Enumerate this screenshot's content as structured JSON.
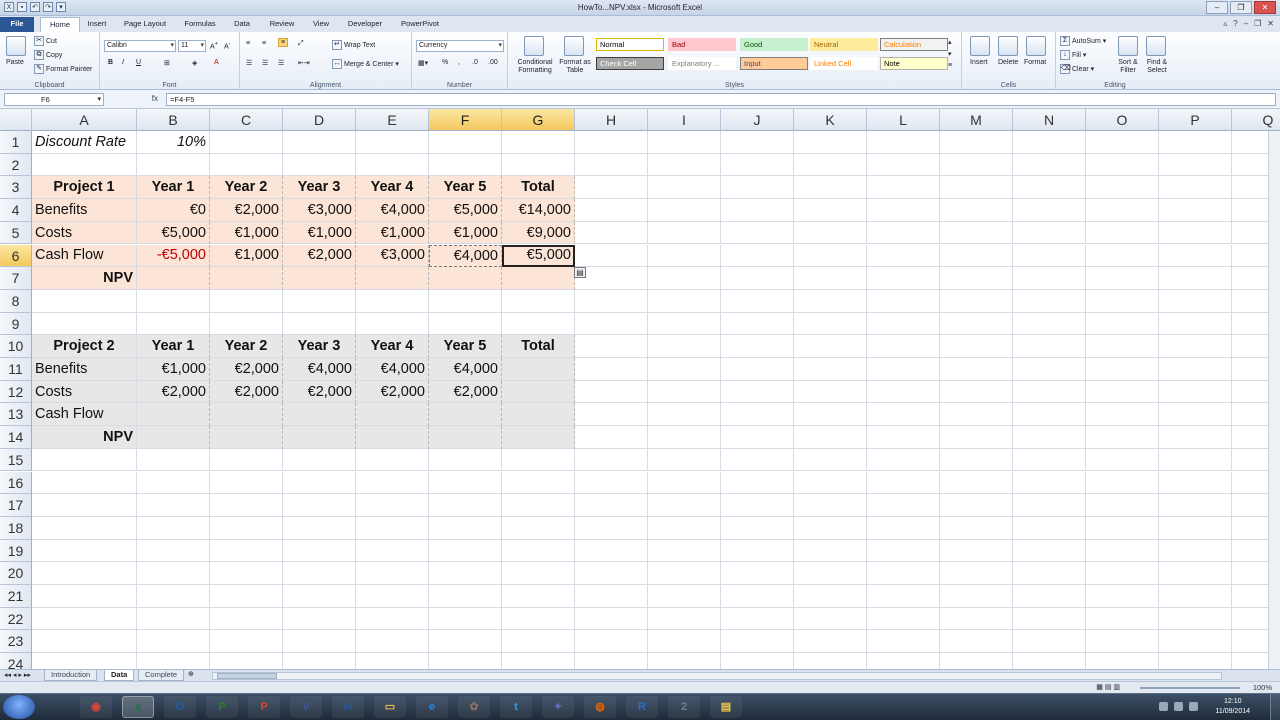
{
  "window": {
    "title": "HowTo...NPV.xlsx - Microsoft Excel",
    "qat_icons": [
      "save-icon",
      "undo-icon",
      "redo-icon",
      "customize-icon"
    ]
  },
  "ribbon_tabs": [
    "File",
    "Home",
    "Insert",
    "Page Layout",
    "Formulas",
    "Data",
    "Review",
    "View",
    "Developer",
    "PowerPivot"
  ],
  "ribbon": {
    "clipboard": {
      "paste": "Paste",
      "cut": "Cut",
      "copy": "Copy",
      "format_painter": "Format Painter",
      "label": "Clipboard"
    },
    "font": {
      "name": "Calibri",
      "size": "11",
      "label": "Font"
    },
    "alignment": {
      "wrap": "Wrap Text",
      "merge": "Merge & Center",
      "label": "Alignment"
    },
    "number": {
      "format": "Currency",
      "label": "Number"
    },
    "styles": {
      "conditional": "Conditional Formatting",
      "format_table": "Format as Table",
      "label": "Styles",
      "gallery": [
        {
          "name": "Normal",
          "bg": "#ffffff",
          "fg": "#000000",
          "border": "#e3b400"
        },
        {
          "name": "Bad",
          "bg": "#ffc7ce",
          "fg": "#9c0006",
          "border": "#ffc7ce"
        },
        {
          "name": "Good",
          "bg": "#c6efce",
          "fg": "#006100",
          "border": "#c6efce"
        },
        {
          "name": "Neutral",
          "bg": "#ffeb9c",
          "fg": "#9c6500",
          "border": "#ffeb9c"
        },
        {
          "name": "Calculation",
          "bg": "#f2f2f2",
          "fg": "#fa7d00",
          "border": "#7f7f7f"
        },
        {
          "name": "Check Cell",
          "bg": "#a5a5a5",
          "fg": "#ffffff",
          "border": "#3f3f3f"
        },
        {
          "name": "Explanatory ...",
          "bg": "#ffffff",
          "fg": "#7f7f7f",
          "border": "#ffffff"
        },
        {
          "name": "Input",
          "bg": "#ffcc99",
          "fg": "#3f3f76",
          "border": "#7f7f7f"
        },
        {
          "name": "Linked Cell",
          "bg": "#ffffff",
          "fg": "#fa7d00",
          "border": "#ffffff"
        },
        {
          "name": "Note",
          "bg": "#ffffcc",
          "fg": "#000000",
          "border": "#b2b2b2"
        }
      ]
    },
    "cells": {
      "insert": "Insert",
      "delete": "Delete",
      "format": "Format",
      "label": "Cells"
    },
    "editing": {
      "autosum": "AutoSum",
      "fill": "Fill",
      "clear": "Clear",
      "sort": "Sort & Filter",
      "find": "Find & Select",
      "label": "Editing"
    }
  },
  "formula_bar": {
    "name_box": "F6",
    "fx": "fx",
    "formula": "=F4-F5"
  },
  "columns": [
    "A",
    "B",
    "C",
    "D",
    "E",
    "F",
    "G",
    "H",
    "I",
    "J",
    "K",
    "L",
    "M",
    "N",
    "O",
    "P",
    "Q"
  ],
  "rows": [
    "1",
    "2",
    "3",
    "4",
    "5",
    "6",
    "7",
    "8",
    "9",
    "10",
    "11",
    "12",
    "13",
    "14",
    "15",
    "16",
    "17",
    "18",
    "19",
    "20",
    "21",
    "22",
    "23",
    "24"
  ],
  "cells": {
    "A1": "Discount Rate",
    "B1": "10%",
    "A3": "Project 1",
    "B3": "Year 1",
    "C3": "Year 2",
    "D3": "Year 3",
    "E3": "Year 4",
    "F3": "Year 5",
    "G3": "Total",
    "A4": "Benefits",
    "B4": "€0",
    "C4": "€2,000",
    "D4": "€3,000",
    "E4": "€4,000",
    "F4": "€5,000",
    "G4": "€14,000",
    "A5": "Costs",
    "B5": "€5,000",
    "C5": "€1,000",
    "D5": "€1,000",
    "E5": "€1,000",
    "F5": "€1,000",
    "G5": "€9,000",
    "A6": "Cash Flow",
    "B6": "-€5,000",
    "C6": "€1,000",
    "D6": "€2,000",
    "E6": "€3,000",
    "F6": "€4,000",
    "G6": "€5,000",
    "A7": "NPV",
    "A10": "Project 2",
    "B10": "Year 1",
    "C10": "Year 2",
    "D10": "Year 3",
    "E10": "Year 4",
    "F10": "Year 5",
    "G10": "Total",
    "A11": "Benefits",
    "B11": "€1,000",
    "C11": "€2,000",
    "D11": "€4,000",
    "E11": "€4,000",
    "F11": "€4,000",
    "A12": "Costs",
    "B12": "€2,000",
    "C12": "€2,000",
    "D12": "€2,000",
    "E12": "€2,000",
    "F12": "€2,000",
    "A13": "Cash Flow",
    "A14": "NPV"
  },
  "sheet_tabs": [
    "Introduction",
    "Data",
    "Complete"
  ],
  "active_sheet": "Data",
  "status": {
    "zoom": "100%"
  },
  "clock": {
    "time": "12:10",
    "date": "11/09/2014"
  },
  "colors": {
    "project1_fill": "#fce4d6",
    "project2_fill": "#e7e7e7",
    "negative": "#c00000",
    "selection_header": "#f4c95d"
  },
  "taskbar_apps": [
    {
      "name": "chrome-icon",
      "glyph": "◉",
      "color": "#d9463b"
    },
    {
      "name": "excel-icon",
      "glyph": "X",
      "color": "#1f7244",
      "active": true
    },
    {
      "name": "outlook-icon",
      "glyph": "O",
      "color": "#1f5fa8"
    },
    {
      "name": "project-icon",
      "glyph": "P",
      "color": "#2e7d32"
    },
    {
      "name": "powerpoint-icon",
      "glyph": "P",
      "color": "#d24726"
    },
    {
      "name": "visio-icon",
      "glyph": "V",
      "color": "#3955a3"
    },
    {
      "name": "word-icon",
      "glyph": "W",
      "color": "#2b579a"
    },
    {
      "name": "folder-icon",
      "glyph": "▭",
      "color": "#e8b84a"
    },
    {
      "name": "ie-icon",
      "glyph": "e",
      "color": "#1e88e5"
    },
    {
      "name": "gimp-icon",
      "glyph": "✿",
      "color": "#8d6e63"
    },
    {
      "name": "twitter-icon",
      "glyph": "t",
      "color": "#1da1f2"
    },
    {
      "name": "tools-icon",
      "glyph": "✦",
      "color": "#5c6bc0"
    },
    {
      "name": "firefox-icon",
      "glyph": "◍",
      "color": "#e66000"
    },
    {
      "name": "r-icon",
      "glyph": "R",
      "color": "#276dc3"
    },
    {
      "name": "cluster-icon",
      "glyph": "2",
      "color": "#6d7f99"
    },
    {
      "name": "notes-icon",
      "glyph": "▤",
      "color": "#f2c94c"
    }
  ]
}
